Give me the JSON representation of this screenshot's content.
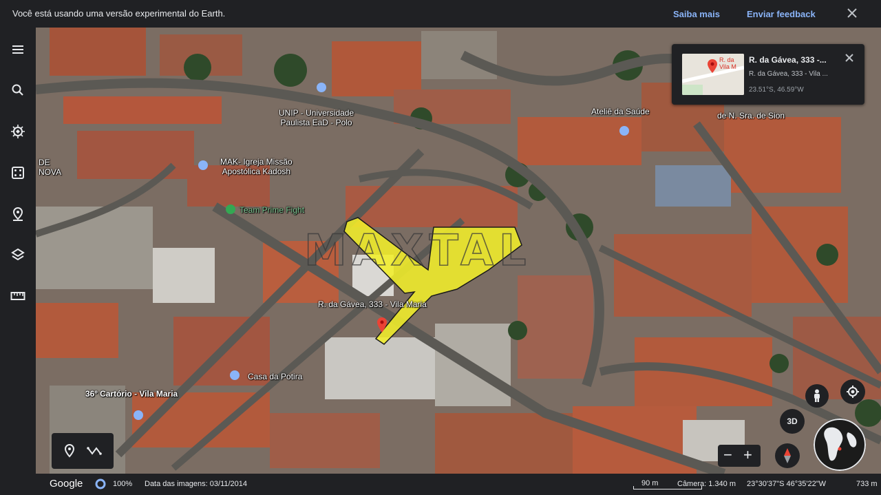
{
  "banner": {
    "message": "Você está usando uma versão experimental do Earth.",
    "learn_more": "Saiba mais",
    "feedback": "Enviar feedback"
  },
  "rail": {
    "icons": [
      "menu-icon",
      "search-icon",
      "voyager-icon",
      "dice-icon",
      "pin-icon",
      "layers-icon",
      "ruler-icon"
    ]
  },
  "map_labels": {
    "unip": "UNIP - Universidade\nPaulista EaD - Polo",
    "mak": "MAK- Igreja Missão\nApostólica Kadosh",
    "prime": "Team Prime Fight",
    "atelie": "Ateliê da Saúde",
    "sion": "de N. Sra. de Sion",
    "nova": "DE\nNOVA",
    "address": "R. da Gávea, 333 - Vila Maria",
    "potira": "Casa da Potira",
    "cartorio": "36º Cartório - Vila Maria",
    "watermark": "MAXTAL"
  },
  "card": {
    "title": "R. da Gávea, 333 -...",
    "subtitle": "R. da Gávea, 333 - Vila ...",
    "coords": "23.51°S, 46.59°W",
    "thumb_label": "R. da\nVila M"
  },
  "controls": {
    "btn_3d": "3D",
    "zoom_out": "−",
    "zoom_in": "+"
  },
  "status": {
    "logo": "Google",
    "zoom": "100%",
    "imagery_date": "Data das imagens: 03/11/2014",
    "scale": "90 m",
    "camera": "Câmera: 1.340 m",
    "coordinates": "23°30'37\"S 46°35'22\"W",
    "elevation": "733 m"
  },
  "colors": {
    "banner_bg": "#202124",
    "link": "#8ab4f8",
    "highlight_polygon": "#f1ee2a",
    "marker": "#ea4335",
    "poi_green": "#34a853",
    "poi_blue": "#8ab4f8"
  }
}
